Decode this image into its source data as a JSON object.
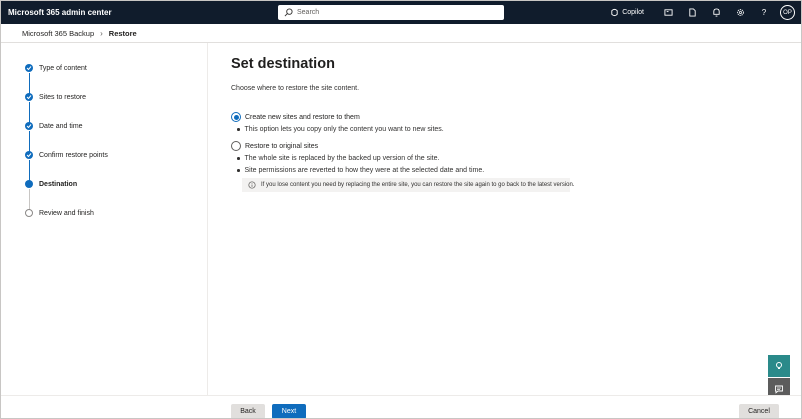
{
  "header": {
    "app_title": "Microsoft 365 admin center",
    "search_placeholder": "Search",
    "copilot_label": "Copilot",
    "avatar_initials": "OP"
  },
  "breadcrumb": {
    "items": [
      "Microsoft 365 Backup",
      "Restore"
    ]
  },
  "steps": [
    {
      "label": "Type of content",
      "status": "done"
    },
    {
      "label": "Sites to restore",
      "status": "done"
    },
    {
      "label": "Date and time",
      "status": "done"
    },
    {
      "label": "Confirm restore points",
      "status": "done"
    },
    {
      "label": "Destination",
      "status": "current"
    },
    {
      "label": "Review and finish",
      "status": "pending"
    }
  ],
  "main": {
    "title": "Set destination",
    "instruction": "Choose where to restore the site content.",
    "options": [
      {
        "label": "Create new sites and restore to them",
        "selected": true,
        "bullets": [
          "This option lets you copy only the content you want to new sites."
        ]
      },
      {
        "label": "Restore to original sites",
        "selected": false,
        "bullets": [
          "The whole site is replaced by the backed up version of the site.",
          "Site permissions are reverted to how they were at the selected date and time."
        ]
      }
    ],
    "info_text": "If you lose content you need by replacing the entire site, you can restore the site again to go back to the latest version."
  },
  "footer": {
    "back_label": "Back",
    "next_label": "Next",
    "cancel_label": "Cancel"
  },
  "colors": {
    "topbar": "#101c2c",
    "accent": "#0f6cbd",
    "teal_widget": "#2a8a8a"
  }
}
